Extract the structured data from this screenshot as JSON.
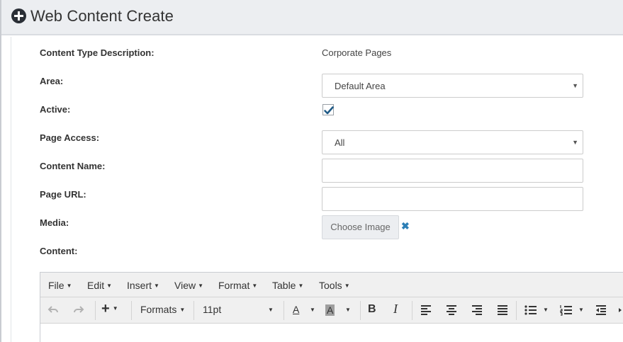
{
  "header": {
    "title": "Web Content Create",
    "icon": "plus-circle-icon"
  },
  "form": {
    "content_type_description": {
      "label": "Content Type Description:",
      "value": "Corporate Pages"
    },
    "area": {
      "label": "Area:",
      "selected": "Default Area"
    },
    "active": {
      "label": "Active:",
      "checked": true
    },
    "page_access": {
      "label": "Page Access:",
      "selected": "All"
    },
    "content_name": {
      "label": "Content Name:",
      "value": ""
    },
    "page_url": {
      "label": "Page URL:",
      "value": ""
    },
    "media": {
      "label": "Media:",
      "button": "Choose Image",
      "clear_icon": "close-icon"
    },
    "content": {
      "label": "Content:"
    }
  },
  "editor": {
    "menu": [
      "File",
      "Edit",
      "Insert",
      "View",
      "Format",
      "Table",
      "Tools"
    ],
    "toolbar": {
      "formats_label": "Formats",
      "font_size": "11pt",
      "text_color_glyph": "A",
      "bg_color_glyph": "A",
      "bold_glyph": "B",
      "italic_glyph": "I"
    }
  },
  "colors": {
    "accent": "#2d7fb6",
    "check": "#1f5a86",
    "header_bg": "#eceef1"
  }
}
